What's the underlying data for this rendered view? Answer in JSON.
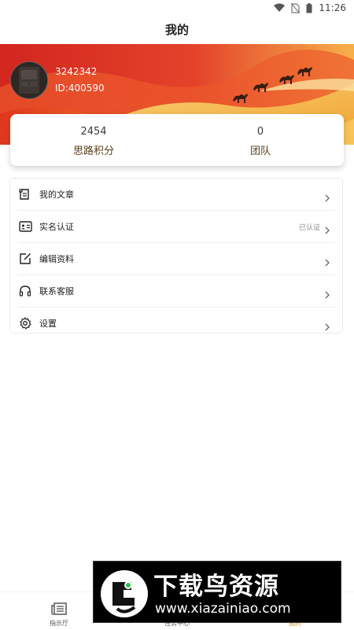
{
  "status_bar": {
    "time": "11:26"
  },
  "header": {
    "title": "我的"
  },
  "profile": {
    "name": "3242342",
    "id_text": "ID:400590"
  },
  "stats": [
    {
      "value": "2454",
      "label": "思路积分"
    },
    {
      "value": "0",
      "label": "团队"
    }
  ],
  "menu": {
    "items": [
      {
        "label": "我的文章",
        "icon": "article-icon",
        "status": ""
      },
      {
        "label": "实名认证",
        "icon": "id-card-icon",
        "status": "已认证"
      },
      {
        "label": "编辑资料",
        "icon": "edit-icon",
        "status": ""
      },
      {
        "label": "联系客服",
        "icon": "headset-icon",
        "status": ""
      },
      {
        "label": "设置",
        "icon": "gear-icon",
        "status": ""
      }
    ]
  },
  "bottom_nav": {
    "items": [
      {
        "label": "指示厅",
        "icon": "newspaper-icon",
        "active": false
      },
      {
        "label": "任务中心",
        "icon": "task-icon",
        "active": false
      },
      {
        "label": "我的",
        "icon": "profile-icon",
        "active": true
      }
    ]
  },
  "watermark": {
    "title": "下载鸟资源",
    "url": "www.xiazainiao.com"
  },
  "colors": {
    "accent": "#c7912e",
    "banner_red": "#d8261f",
    "banner_gold": "#f4b53c",
    "stat_label": "#5a3e1a"
  }
}
